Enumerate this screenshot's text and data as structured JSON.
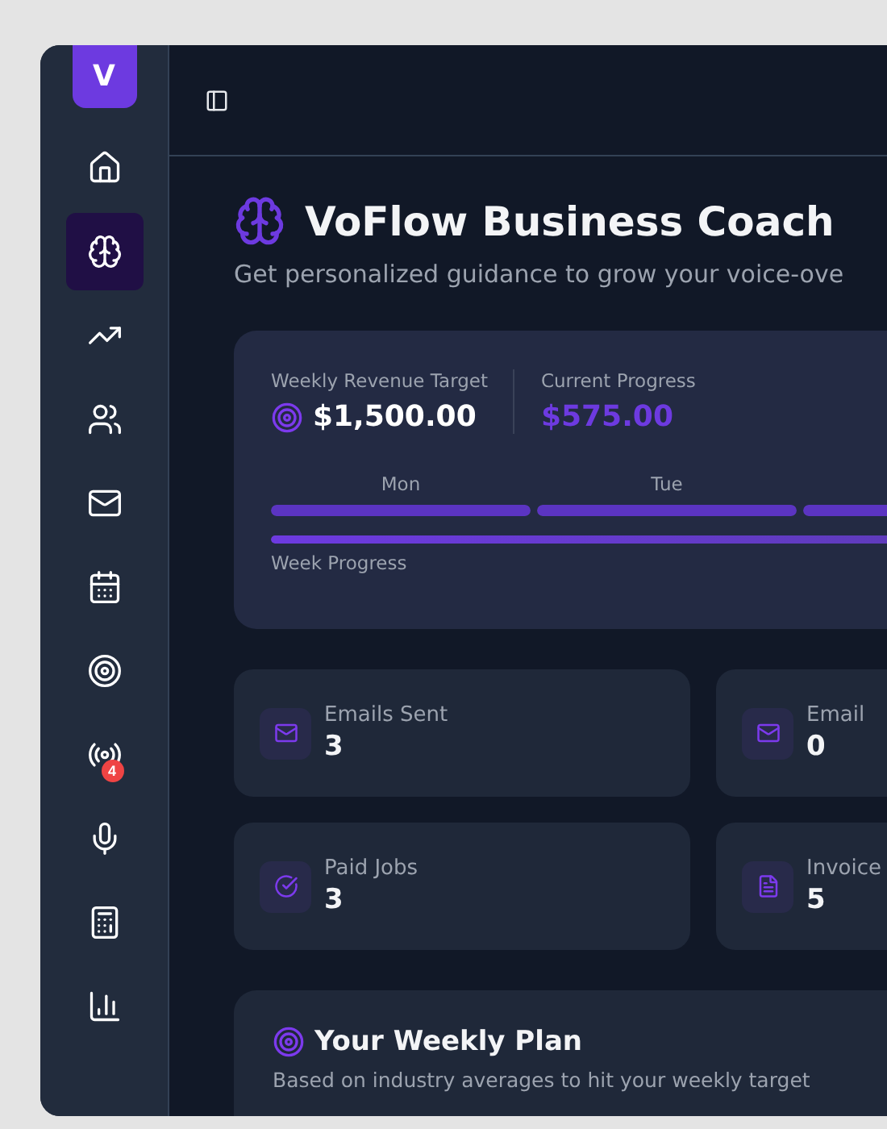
{
  "sidebar": {
    "logo": "V",
    "items": [
      {
        "selected": false
      },
      {
        "selected": true
      },
      {
        "selected": false
      },
      {
        "selected": false
      },
      {
        "selected": false
      },
      {
        "selected": false
      },
      {
        "selected": false
      },
      {
        "selected": false,
        "badge": "4"
      },
      {
        "selected": false
      },
      {
        "selected": false
      },
      {
        "selected": false
      }
    ]
  },
  "header": {
    "title": "VoFlow Business Coach",
    "subtitle": "Get personalized guidance to grow your voice-ove"
  },
  "revenue": {
    "target_label": "Weekly Revenue Target",
    "target": "$1,500.00",
    "progress_label": "Current Progress",
    "progress": "$575.00",
    "days": [
      {
        "kind": "day",
        "label": "Mon",
        "level": 1
      },
      {
        "kind": "day",
        "label": "Tue",
        "level": 1
      },
      {
        "kind": "bar",
        "level": 1
      }
    ],
    "week_progress": {
      "label": "Week Progress",
      "level": 1
    }
  },
  "stats": [
    {
      "label": "Emails Sent",
      "value": "3"
    },
    {
      "label": "Email",
      "value": "0"
    },
    {
      "label": "Paid Jobs",
      "value": "3"
    },
    {
      "label": "Invoice",
      "value": "5"
    }
  ],
  "plan": {
    "title": "Your Weekly Plan",
    "subtitle": "Based on industry averages to hit your weekly target"
  }
}
